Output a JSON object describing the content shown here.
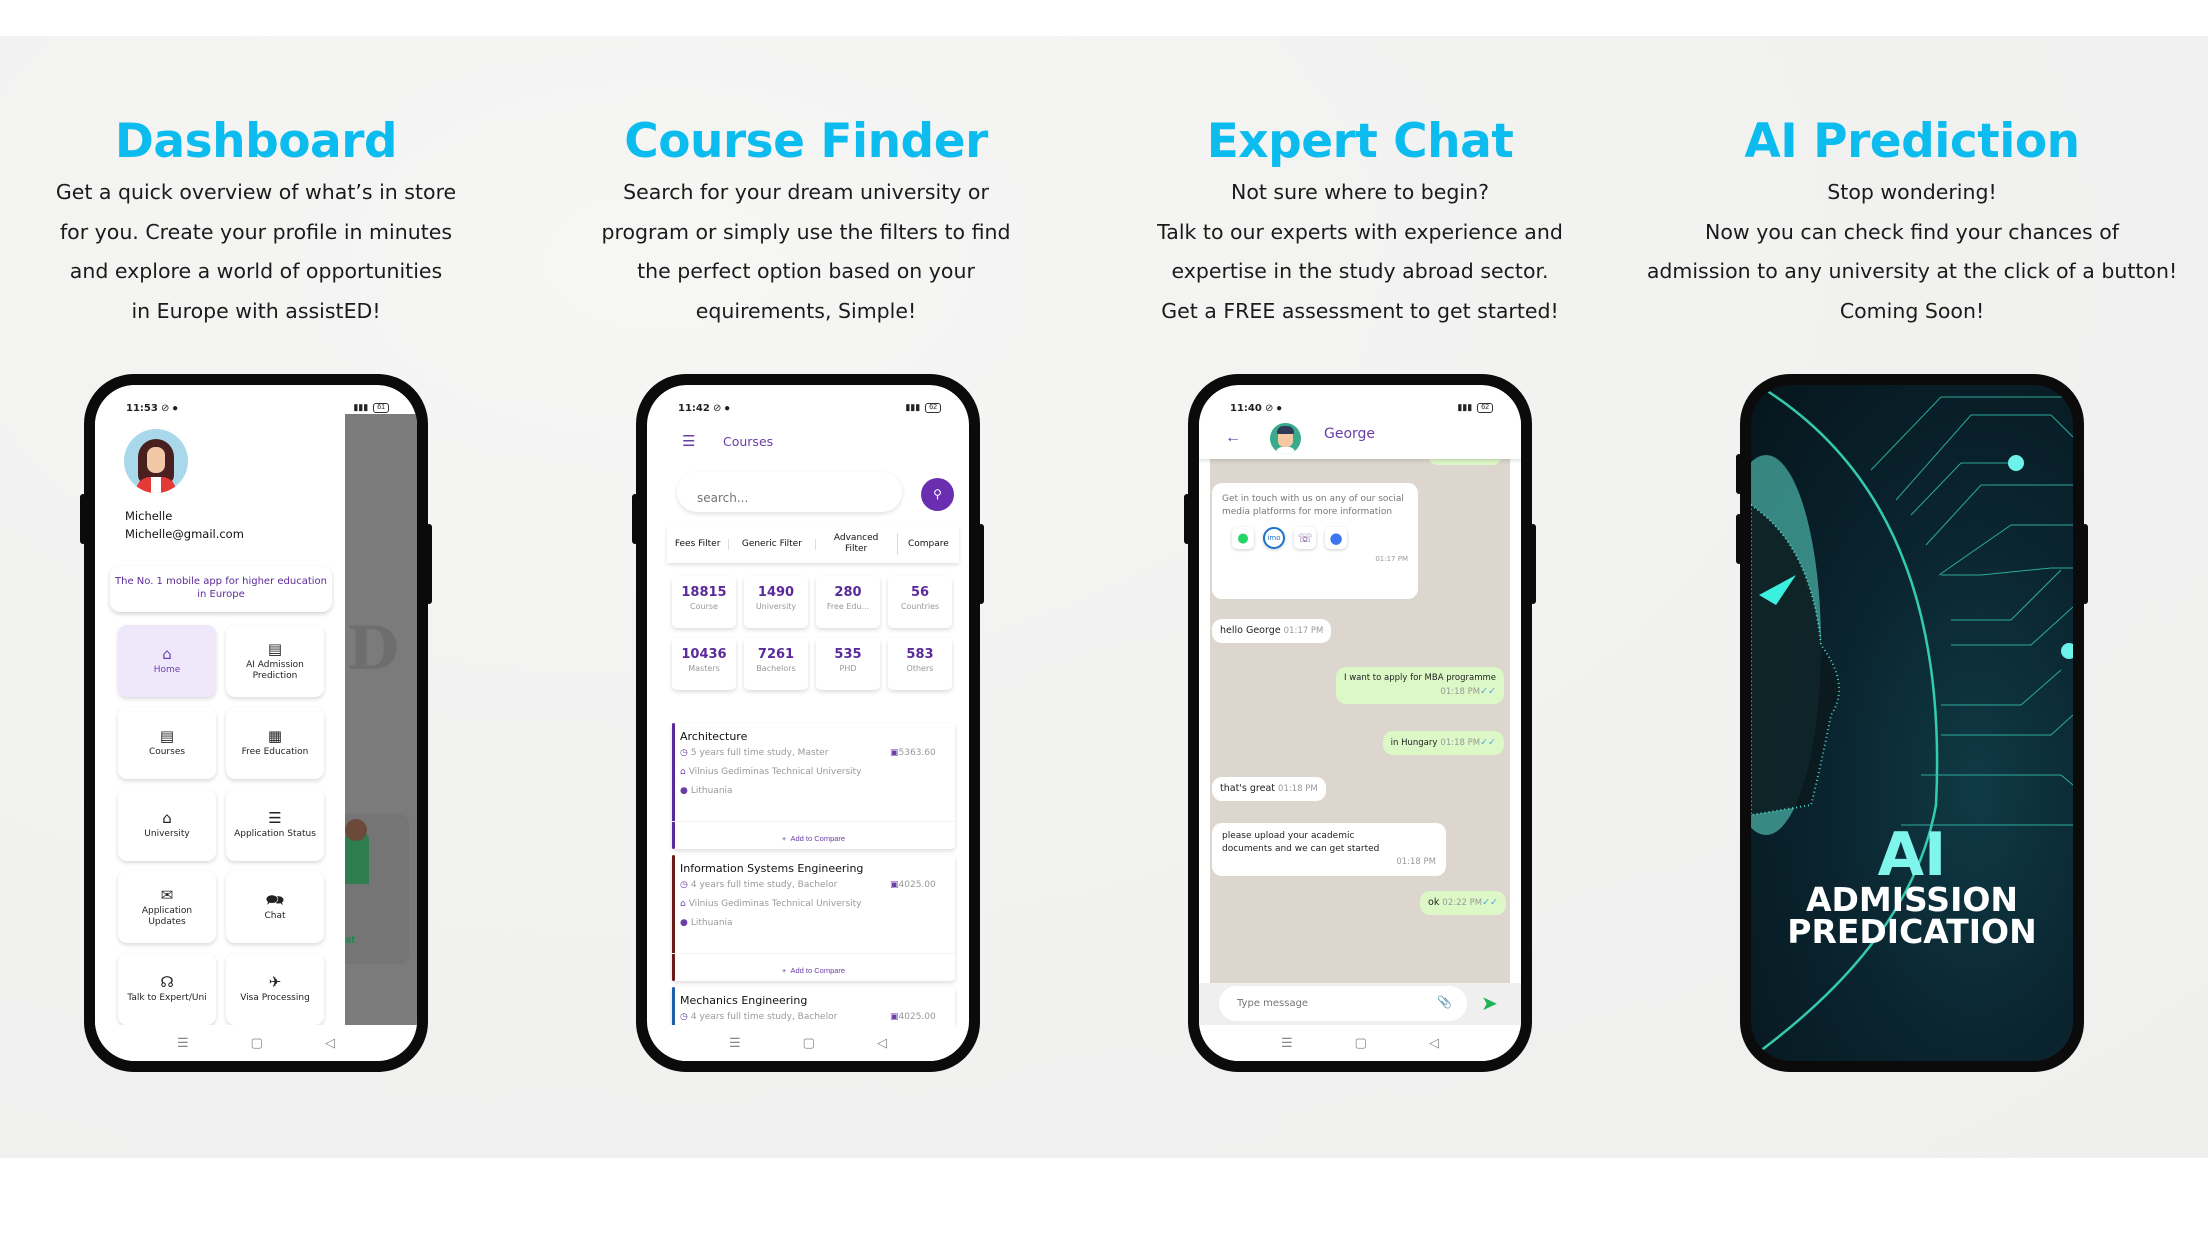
{
  "sections": [
    {
      "title": "Dashboard",
      "lines": [
        "Get a quick overview of what’s in store",
        "for you. Create your profile in minutes",
        "and explore a world of opportunities",
        "in Europe with assistED!"
      ]
    },
    {
      "title": "Course Finder",
      "lines": [
        "Search for your dream university or",
        "program or simply use the filters to find",
        "the perfect option based on your",
        "equirements, Simple!"
      ]
    },
    {
      "title": "Expert Chat",
      "lines": [
        "Not sure where to begin?",
        "Talk to our experts with experience and",
        "expertise in the study abroad sector.",
        "Get a FREE assessment to get started!"
      ]
    },
    {
      "title": "AI Prediction",
      "lines": [
        "Stop wondering!",
        "Now you can check find your chances of",
        "admission to any university at the click of a button!",
        "Coming Soon!"
      ]
    }
  ],
  "colors": {
    "heading": "#0cbcee",
    "accent": "#6a3ea6",
    "chat_bg": "#dcd6cf",
    "outgoing": "#dcf8c6"
  },
  "dashboard": {
    "status": {
      "time": "11:53",
      "battery": "61"
    },
    "user": {
      "name": "Michelle",
      "email": "Michelle@gmail.com"
    },
    "tagline": "The No. 1 mobile app for higher education in Europe",
    "tiles": [
      {
        "label": "Home",
        "icon": "home-icon",
        "glyph": "⌂",
        "active": true
      },
      {
        "label": "AI Admission Prediction",
        "icon": "book-icon",
        "glyph": "▤"
      },
      {
        "label": "Courses",
        "icon": "book-icon",
        "glyph": "▤"
      },
      {
        "label": "Free Education",
        "icon": "building-icon",
        "glyph": "▦"
      },
      {
        "label": "University",
        "icon": "university-icon",
        "glyph": "⌂"
      },
      {
        "label": "Application Status",
        "icon": "document-icon",
        "glyph": "☰"
      },
      {
        "label": "Application Updates",
        "icon": "envelope-icon",
        "glyph": "✉"
      },
      {
        "label": "Chat",
        "icon": "chat-bubbles-icon",
        "glyph": "💬"
      },
      {
        "label": "Talk to Expert/Uni",
        "icon": "headset-icon",
        "glyph": "☊"
      },
      {
        "label": "Visa Processing",
        "icon": "plane-icon",
        "glyph": "✈"
      }
    ],
    "background_fragment": "at"
  },
  "courses": {
    "status": {
      "time": "11:42",
      "battery": "62"
    },
    "title": "Courses",
    "search_placeholder": "search...",
    "filters": [
      "Fees Filter",
      "Generic Filter",
      "Advanced Filter",
      "Compare"
    ],
    "stats": [
      {
        "value": "18815",
        "label": "Course"
      },
      {
        "value": "1490",
        "label": "University"
      },
      {
        "value": "280",
        "label": "Free Edu..."
      },
      {
        "value": "56",
        "label": "Countries"
      },
      {
        "value": "10436",
        "label": "Masters"
      },
      {
        "value": "7261",
        "label": "Bachelors"
      },
      {
        "value": "535",
        "label": "PHD"
      },
      {
        "value": "583",
        "label": "Others"
      }
    ],
    "list": [
      {
        "title": "Architecture",
        "duration": "5 years full time study, Master",
        "fee": "5363.60",
        "university": "Vilnius Gediminas Technical University",
        "country": "Lithuania",
        "action": "Add to Compare",
        "bar_color": "#5a2a9a"
      },
      {
        "title": "Information Systems Engineering",
        "duration": "4 years full time study, Bachelor",
        "fee": "4025.00",
        "university": "Vilnius Gediminas Technical University",
        "country": "Lithuania",
        "action": "Add to Compare",
        "bar_color": "#6b1a1a"
      },
      {
        "title": "Mechanics Engineering",
        "duration": "4 years full time study, Bachelor",
        "fee": "4025.00",
        "university": "",
        "country": "",
        "action": "",
        "bar_color": "#1f5fa8"
      }
    ]
  },
  "chat": {
    "status": {
      "time": "11:40",
      "battery": "62"
    },
    "contact": "George",
    "messages": [
      {
        "dir": "in",
        "text": "Get in touch with us on any of our social media platforms for more information",
        "time": "01:17 PM",
        "socials": [
          "whatsapp",
          "imo",
          "viber",
          "signal"
        ]
      },
      {
        "dir": "in",
        "text": "hello George",
        "time": "01:17 PM"
      },
      {
        "dir": "out",
        "text": "I want to apply for MBA programme",
        "time": "01:18 PM"
      },
      {
        "dir": "out",
        "text": "in Hungary",
        "time": "01:18 PM"
      },
      {
        "dir": "in",
        "text": "that's great",
        "time": "01:18 PM"
      },
      {
        "dir": "in",
        "text": "please upload your academic documents and we can get started",
        "time": "01:18 PM"
      },
      {
        "dir": "out",
        "text": "ok",
        "time": "02:22 PM"
      }
    ],
    "input_placeholder": "Type message"
  },
  "ai": {
    "title_big": "AI",
    "title_line1": "ADMISSION",
    "title_line2": "PREDICATION"
  }
}
